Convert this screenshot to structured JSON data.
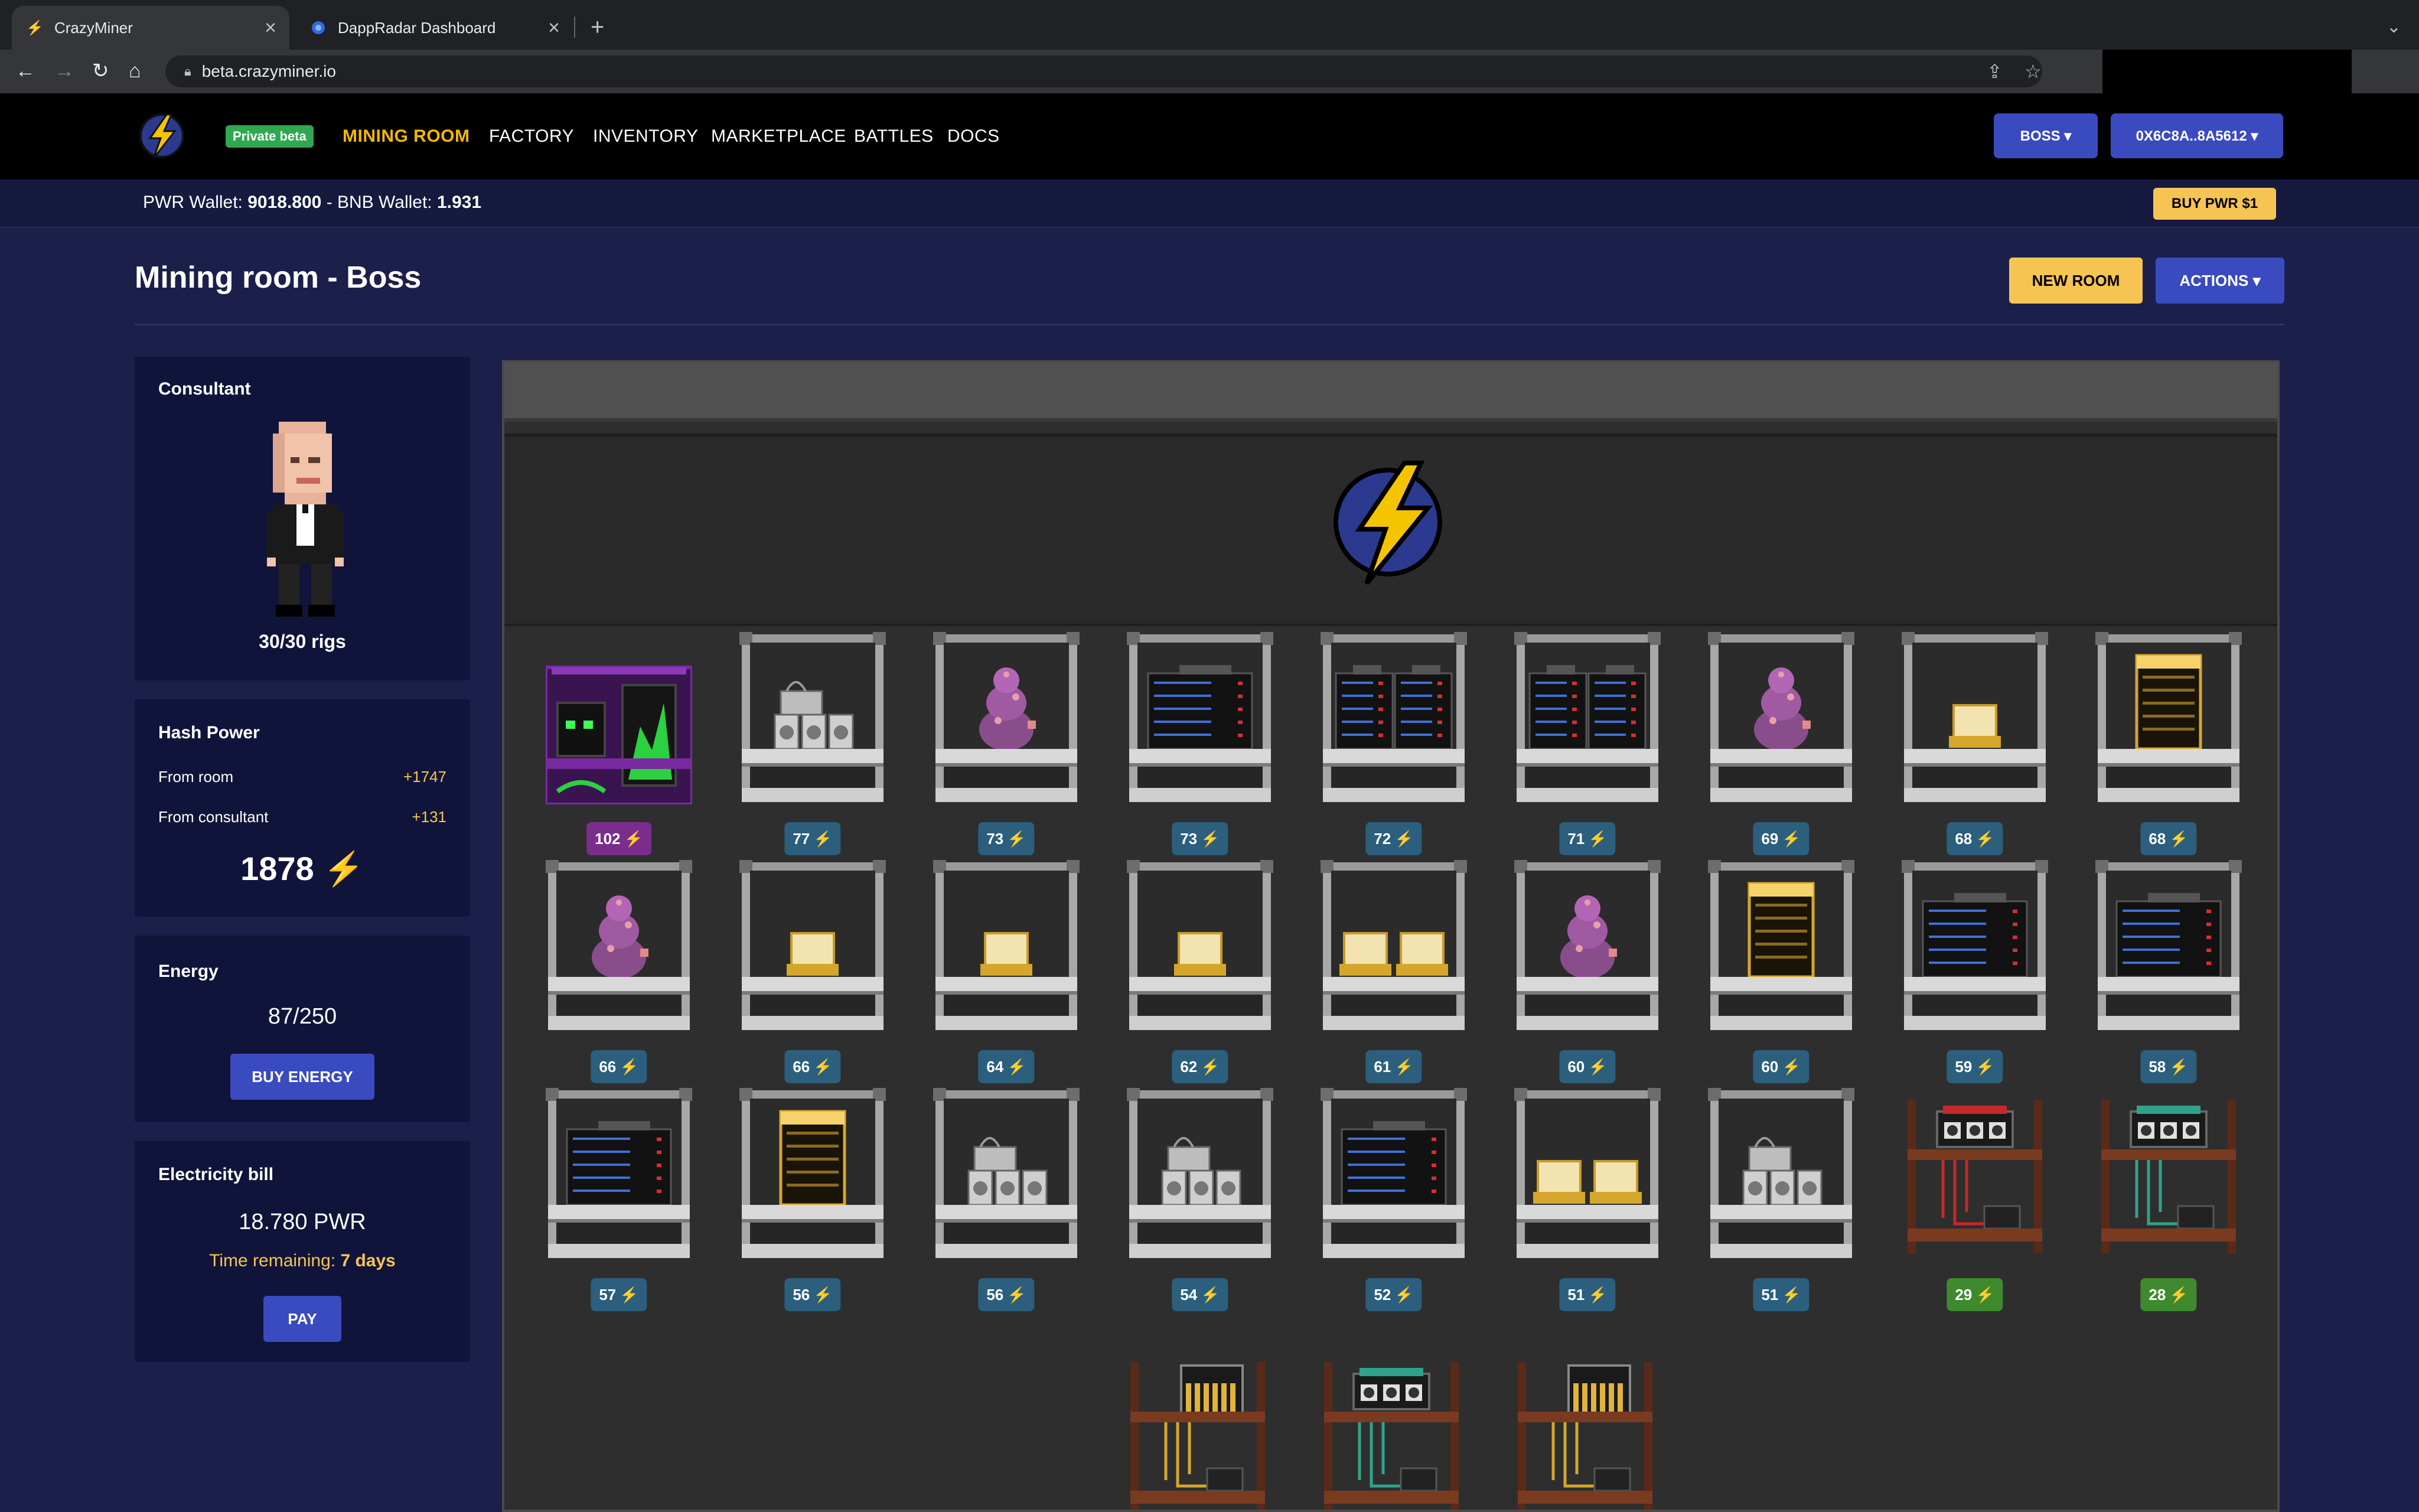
{
  "browser": {
    "tabs": [
      {
        "title": "CrazyMiner",
        "active": true,
        "icon": "bolt-favicon-icon"
      },
      {
        "title": "DappRadar Dashboard",
        "active": false,
        "icon": "dappradar-favicon-icon"
      }
    ],
    "url": "beta.crazyminer.io"
  },
  "nav": {
    "badge": "Private beta",
    "links": [
      "MINING ROOM",
      "FACTORY",
      "INVENTORY",
      "MARKETPLACE",
      "BATTLES",
      "DOCS"
    ],
    "active_link": "MINING ROOM",
    "boss_button": "BOSS ▾",
    "wallet_button": "0X6C8A..8A5612 ▾"
  },
  "wallet": {
    "pwr_label": "PWR Wallet: ",
    "pwr_value": "9018.800",
    "sep": " - BNB Wallet: ",
    "bnb_value": "1.931",
    "buy_button": "BUY PWR $1"
  },
  "page": {
    "title": "Mining room - Boss",
    "new_room_button": "NEW ROOM",
    "actions_button": "ACTIONS ▾"
  },
  "consultant": {
    "title": "Consultant",
    "rigs": "30/30 rigs"
  },
  "hash_power": {
    "title": "Hash Power",
    "from_room_label": "From room",
    "from_room_value": "+1747",
    "from_consultant_label": "From consultant",
    "from_consultant_value": "+131",
    "total": "1878"
  },
  "energy": {
    "title": "Energy",
    "value": "87/250",
    "button": "BUY ENERGY"
  },
  "electricity": {
    "title": "Electricity bill",
    "amount": "18.780 PWR",
    "remaining_label": "Time remaining: ",
    "remaining_value": "7 days",
    "button": "PAY"
  },
  "bolt_glyph": "⚡",
  "rigs": [
    {
      "power": "102",
      "type": "alien",
      "badge": "purple"
    },
    {
      "power": "77",
      "type": "asic",
      "badge": "blue"
    },
    {
      "power": "73",
      "type": "mushroom",
      "badge": "blue"
    },
    {
      "power": "73",
      "type": "server",
      "badge": "blue"
    },
    {
      "power": "72",
      "type": "server-double",
      "badge": "blue"
    },
    {
      "power": "71",
      "type": "server-double",
      "badge": "blue"
    },
    {
      "power": "69",
      "type": "mushroom",
      "badge": "blue"
    },
    {
      "power": "68",
      "type": "gold-small",
      "badge": "blue"
    },
    {
      "power": "68",
      "type": "gold-rack",
      "badge": "blue"
    },
    {
      "power": "66",
      "type": "mushroom",
      "badge": "blue"
    },
    {
      "power": "66",
      "type": "gold-small",
      "badge": "blue"
    },
    {
      "power": "64",
      "type": "gold-small",
      "badge": "blue"
    },
    {
      "power": "62",
      "type": "gold-small",
      "badge": "blue"
    },
    {
      "power": "61",
      "type": "gold-double",
      "badge": "blue"
    },
    {
      "power": "60",
      "type": "mushroom",
      "badge": "blue"
    },
    {
      "power": "60",
      "type": "gold-rack",
      "badge": "blue"
    },
    {
      "power": "59",
      "type": "server",
      "badge": "blue"
    },
    {
      "power": "58",
      "type": "server",
      "badge": "blue"
    },
    {
      "power": "57",
      "type": "server",
      "badge": "blue"
    },
    {
      "power": "56",
      "type": "gold-rack",
      "badge": "blue"
    },
    {
      "power": "56",
      "type": "asic",
      "badge": "blue"
    },
    {
      "power": "54",
      "type": "asic",
      "badge": "blue"
    },
    {
      "power": "52",
      "type": "server",
      "badge": "blue"
    },
    {
      "power": "51",
      "type": "gold-double",
      "badge": "blue"
    },
    {
      "power": "51",
      "type": "asic",
      "badge": "blue"
    },
    {
      "power": "29",
      "type": "wood-red",
      "badge": "green"
    },
    {
      "power": "28",
      "type": "wood-teal",
      "badge": "green"
    },
    {
      "power": "",
      "type": "wood-gold",
      "badge": "green"
    },
    {
      "power": "",
      "type": "wood-teal",
      "badge": "green"
    },
    {
      "power": "",
      "type": "wood-gold",
      "badge": "green"
    }
  ]
}
